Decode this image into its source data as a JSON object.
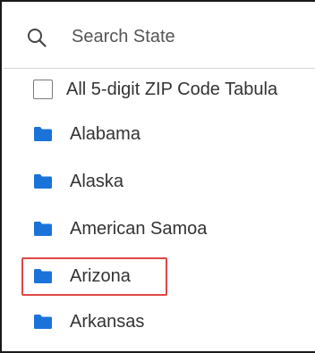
{
  "search": {
    "placeholder": "Search State",
    "value": ""
  },
  "list": {
    "all_option": {
      "label": "All 5-digit ZIP Code Tabula",
      "checked": false
    },
    "items": [
      {
        "label": "Alabama"
      },
      {
        "label": "Alaska"
      },
      {
        "label": "American Samoa"
      },
      {
        "label": "Arizona"
      },
      {
        "label": "Arkansas"
      }
    ]
  },
  "colors": {
    "folder": "#1a73d9",
    "highlight": "#e04646",
    "text": "#333333",
    "border": "#1a1a1a"
  }
}
